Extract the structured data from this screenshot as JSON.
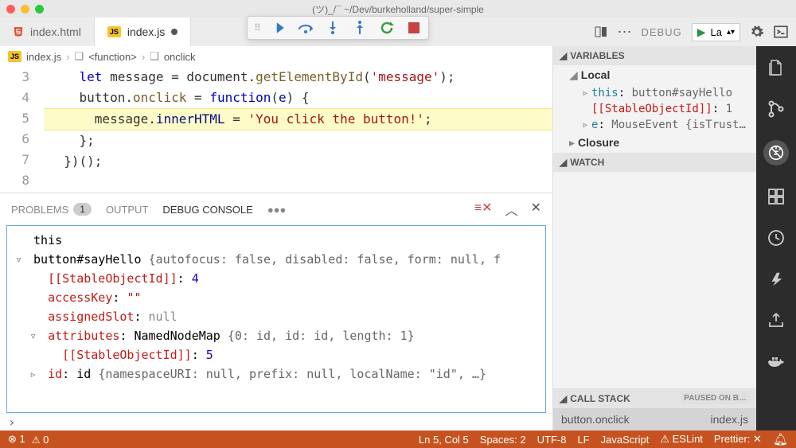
{
  "title": "(ツ)_/¯ ~/Dev/burkeholland/super-simple",
  "tabs": [
    {
      "label": "index.html",
      "icon": "html",
      "active": false,
      "dirty": false
    },
    {
      "label": "index.js",
      "icon": "js",
      "active": true,
      "dirty": true
    }
  ],
  "debug_dropdown": {
    "label": "DEBUG",
    "config": "La"
  },
  "breadcrumb": {
    "file_icon": "js",
    "file": "index.js",
    "path": [
      "<function>",
      "onclick"
    ]
  },
  "editor": {
    "lines": [
      {
        "n": 3,
        "indent": 2,
        "tokens": [
          [
            "kw",
            "let"
          ],
          [
            "",
            " message = document."
          ],
          [
            "fn",
            "getElementById"
          ],
          [
            "",
            "("
          ],
          [
            "str",
            "'message'"
          ],
          [
            "",
            ");"
          ]
        ]
      },
      {
        "n": 4,
        "indent": 2,
        "tokens": [
          [
            "",
            "button."
          ],
          [
            "fn",
            "onclick"
          ],
          [
            "",
            " = "
          ],
          [
            "kw",
            "function"
          ],
          [
            "",
            "("
          ],
          [
            "param",
            "e"
          ],
          [
            "",
            ") {"
          ]
        ]
      },
      {
        "n": 5,
        "indent": 3,
        "hl": true,
        "bp": true,
        "tokens": [
          [
            "",
            "message."
          ],
          [
            "param",
            "innerHTML"
          ],
          [
            "",
            " = "
          ],
          [
            "str",
            "'You click the button!'"
          ],
          [
            "",
            ";"
          ]
        ]
      },
      {
        "n": 6,
        "indent": 2,
        "tokens": [
          [
            "",
            "};"
          ]
        ]
      },
      {
        "n": 7,
        "indent": 1,
        "tokens": [
          [
            "",
            "})();"
          ]
        ]
      },
      {
        "n": 8,
        "indent": 0,
        "tokens": []
      }
    ]
  },
  "panel": {
    "tabs": {
      "problems": "PROBLEMS",
      "problems_count": "1",
      "output": "OUTPUT",
      "debug_console": "DEBUG CONSOLE"
    },
    "console": [
      {
        "indent": 0,
        "twist": "",
        "parts": [
          [
            "",
            "this"
          ]
        ]
      },
      {
        "indent": 0,
        "twist": "▿",
        "parts": [
          [
            "",
            "button#sayHello "
          ],
          [
            "obj",
            "{autofocus: false, disabled: false, form: null, f"
          ]
        ]
      },
      {
        "indent": 1,
        "twist": "",
        "parts": [
          [
            "stable",
            "[[StableObjectId]]"
          ],
          [
            "",
            ": "
          ],
          [
            "val-num",
            "4"
          ]
        ]
      },
      {
        "indent": 1,
        "twist": "",
        "parts": [
          [
            "prop",
            "accessKey"
          ],
          [
            "",
            ": "
          ],
          [
            "str",
            "\"\""
          ]
        ]
      },
      {
        "indent": 1,
        "twist": "",
        "parts": [
          [
            "prop",
            "assignedSlot"
          ],
          [
            "",
            ": "
          ],
          [
            "val-null",
            "null"
          ]
        ]
      },
      {
        "indent": 1,
        "twist": "▿",
        "parts": [
          [
            "prop",
            "attributes"
          ],
          [
            "",
            ": NamedNodeMap "
          ],
          [
            "obj",
            "{0: id, id: id, length: 1}"
          ]
        ]
      },
      {
        "indent": 2,
        "twist": "",
        "parts": [
          [
            "stable",
            "[[StableObjectId]]"
          ],
          [
            "",
            ": "
          ],
          [
            "val-num",
            "5"
          ]
        ]
      },
      {
        "indent": 1,
        "twist": "▹",
        "parts": [
          [
            "prop",
            "id"
          ],
          [
            "",
            ": id "
          ],
          [
            "obj",
            "{namespaceURI: null, prefix: null, localName: \"id\", …}"
          ]
        ]
      }
    ]
  },
  "variables": {
    "header": "VARIABLES",
    "scopes": [
      {
        "name": "Local",
        "expanded": true,
        "vars": [
          {
            "twist": "▹",
            "name": "this",
            "val": "button#sayHello"
          },
          {
            "twist": "",
            "name": "[[StableObjectId]]",
            "val": "1",
            "stable": true
          },
          {
            "twist": "▹",
            "name": "e",
            "val": "MouseEvent {isTrust…"
          }
        ]
      },
      {
        "name": "Closure",
        "expanded": false
      }
    ]
  },
  "watch_header": "WATCH",
  "call_stack": {
    "header": "CALL STACK",
    "badge": "PAUSED ON B…",
    "frame": {
      "fn": "button.onclick",
      "file": "index.js"
    }
  },
  "statusbar": {
    "errors": "1",
    "warnings": "0",
    "position": "Ln 5, Col 5",
    "spaces": "Spaces: 2",
    "encoding": "UTF-8",
    "eol": "LF",
    "lang": "JavaScript",
    "eslint": "ESLint",
    "prettier": "Prettier: ✕"
  }
}
